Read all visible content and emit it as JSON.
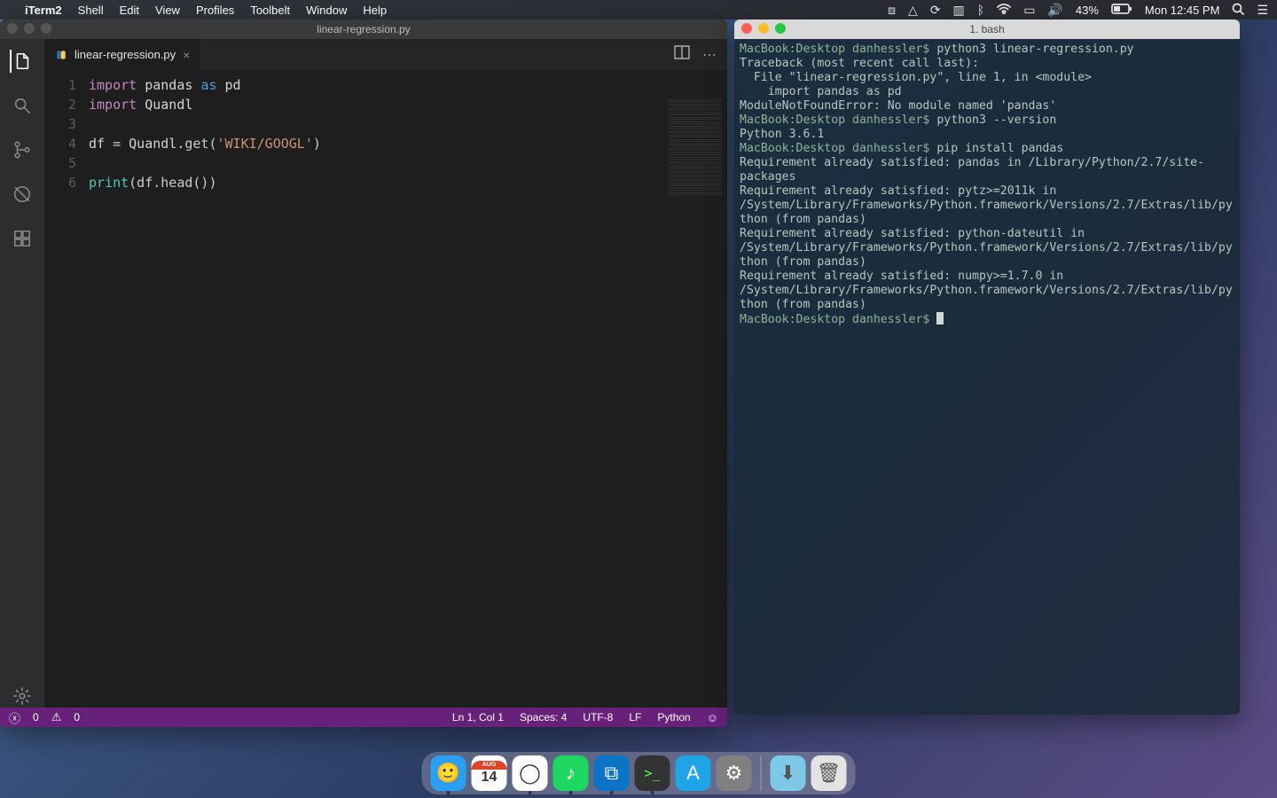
{
  "menubar": {
    "app": "iTerm2",
    "items": [
      "Shell",
      "Edit",
      "View",
      "Profiles",
      "Toolbelt",
      "Window",
      "Help"
    ],
    "battery": "43%",
    "clock": "Mon 12:45 PM"
  },
  "vscode": {
    "title": "linear-regression.py",
    "tab": {
      "filename": "linear-regression.py"
    },
    "code_lines": [
      [
        {
          "c": "tok-kw",
          "t": "import"
        },
        {
          "c": "",
          "t": " "
        },
        {
          "c": "tok-id",
          "t": "pandas"
        },
        {
          "c": "",
          "t": " "
        },
        {
          "c": "tok-as",
          "t": "as"
        },
        {
          "c": "",
          "t": " "
        },
        {
          "c": "tok-id",
          "t": "pd"
        }
      ],
      [
        {
          "c": "tok-kw",
          "t": "import"
        },
        {
          "c": "",
          "t": " "
        },
        {
          "c": "tok-id",
          "t": "Quandl"
        }
      ],
      [],
      [
        {
          "c": "tok-id",
          "t": "df"
        },
        {
          "c": "",
          "t": " = "
        },
        {
          "c": "tok-id",
          "t": "Quandl"
        },
        {
          "c": "",
          "t": ".get("
        },
        {
          "c": "tok-str",
          "t": "'WIKI/GOOGL'"
        },
        {
          "c": "",
          "t": ")"
        }
      ],
      [],
      [
        {
          "c": "tok-fn",
          "t": "print"
        },
        {
          "c": "",
          "t": "(df.head())"
        }
      ]
    ],
    "status": {
      "errors": "0",
      "warnings": "0",
      "cursor": "Ln 1, Col 1",
      "indent": "Spaces: 4",
      "encoding": "UTF-8",
      "eol": "LF",
      "lang": "Python"
    }
  },
  "terminal": {
    "title": "1. bash",
    "prompt": "MacBook:Desktop danhessler$ ",
    "lines": [
      {
        "p": true,
        "cmd": "python3 linear-regression.py"
      },
      {
        "t": "Traceback (most recent call last):"
      },
      {
        "t": "  File \"linear-regression.py\", line 1, in <module>"
      },
      {
        "t": "    import pandas as pd"
      },
      {
        "t": "ModuleNotFoundError: No module named 'pandas'"
      },
      {
        "p": true,
        "cmd": "python3 --version"
      },
      {
        "t": "Python 3.6.1"
      },
      {
        "p": true,
        "cmd": "pip install pandas"
      },
      {
        "t": "Requirement already satisfied: pandas in /Library/Python/2.7/site-packages"
      },
      {
        "t": "Requirement already satisfied: pytz>=2011k in /System/Library/Frameworks/Python.framework/Versions/2.7/Extras/lib/python (from pandas)"
      },
      {
        "t": "Requirement already satisfied: python-dateutil in /System/Library/Frameworks/Python.framework/Versions/2.7/Extras/lib/python (from pandas)"
      },
      {
        "t": "Requirement already satisfied: numpy>=1.7.0 in /System/Library/Frameworks/Python.framework/Versions/2.7/Extras/lib/python (from pandas)"
      },
      {
        "p": true,
        "cmd": "",
        "cursor": true
      }
    ]
  },
  "dock": {
    "apps": [
      {
        "n": "finder",
        "bg": "#2aa0f5",
        "running": true,
        "glyph": "🙂"
      },
      {
        "n": "calendar",
        "bg": "#fff",
        "running": false,
        "glyph": "14",
        "badge": "AUG"
      },
      {
        "n": "chrome",
        "bg": "#fff",
        "running": true,
        "glyph": "◯"
      },
      {
        "n": "spotify",
        "bg": "#1ed760",
        "running": true,
        "glyph": "♪"
      },
      {
        "n": "vscode",
        "bg": "#0b74c6",
        "running": true,
        "glyph": "⧉"
      },
      {
        "n": "iterm",
        "bg": "#333",
        "running": true,
        "glyph": ">_"
      },
      {
        "n": "appstore",
        "bg": "#1fa4e8",
        "running": false,
        "glyph": "A"
      },
      {
        "n": "sysprefs",
        "bg": "#808080",
        "running": false,
        "glyph": "⚙"
      }
    ],
    "right": [
      {
        "n": "downloads",
        "bg": "#7cc8e6",
        "glyph": "⬇"
      },
      {
        "n": "trash",
        "bg": "#e3e3e3",
        "glyph": "🗑"
      }
    ]
  }
}
